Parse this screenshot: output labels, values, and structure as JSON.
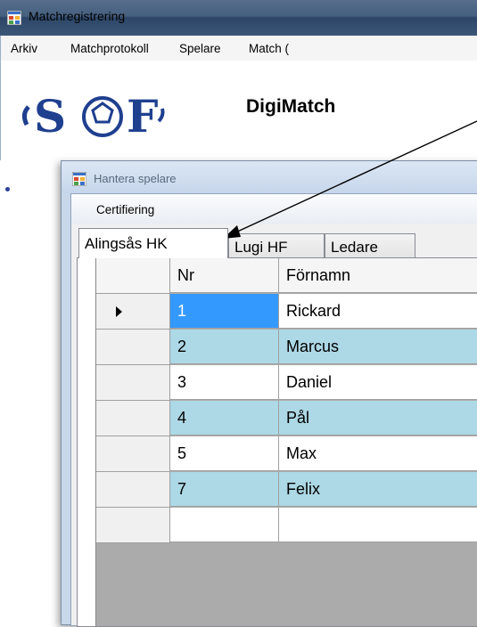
{
  "main_window": {
    "title": "Matchregistrering",
    "menu": [
      "Arkiv",
      "Matchprotokoll",
      "Spelare",
      "Match ("
    ],
    "banner_title": "DigiMatch",
    "logo_text": "SOF"
  },
  "dialog": {
    "title": "Hantera spelare",
    "menu": [
      "Certifiering"
    ],
    "tabs": [
      "Alingsås HK",
      "Lugi HF",
      "Ledare"
    ],
    "active_tab": "Alingsås HK",
    "grid": {
      "columns": [
        "Nr",
        "Förnamn"
      ],
      "rows": [
        {
          "nr": "1",
          "fornamn": "Rickard"
        },
        {
          "nr": "2",
          "fornamn": "Marcus"
        },
        {
          "nr": "3",
          "fornamn": "Daniel"
        },
        {
          "nr": "4",
          "fornamn": "Pål"
        },
        {
          "nr": "5",
          "fornamn": "Max"
        },
        {
          "nr": "7",
          "fornamn": "Felix"
        }
      ],
      "selected_row": 0
    }
  },
  "colors": {
    "alt_row": "#add8e6",
    "selected_cell": "#3399ff",
    "titlebar": "#46607f"
  }
}
